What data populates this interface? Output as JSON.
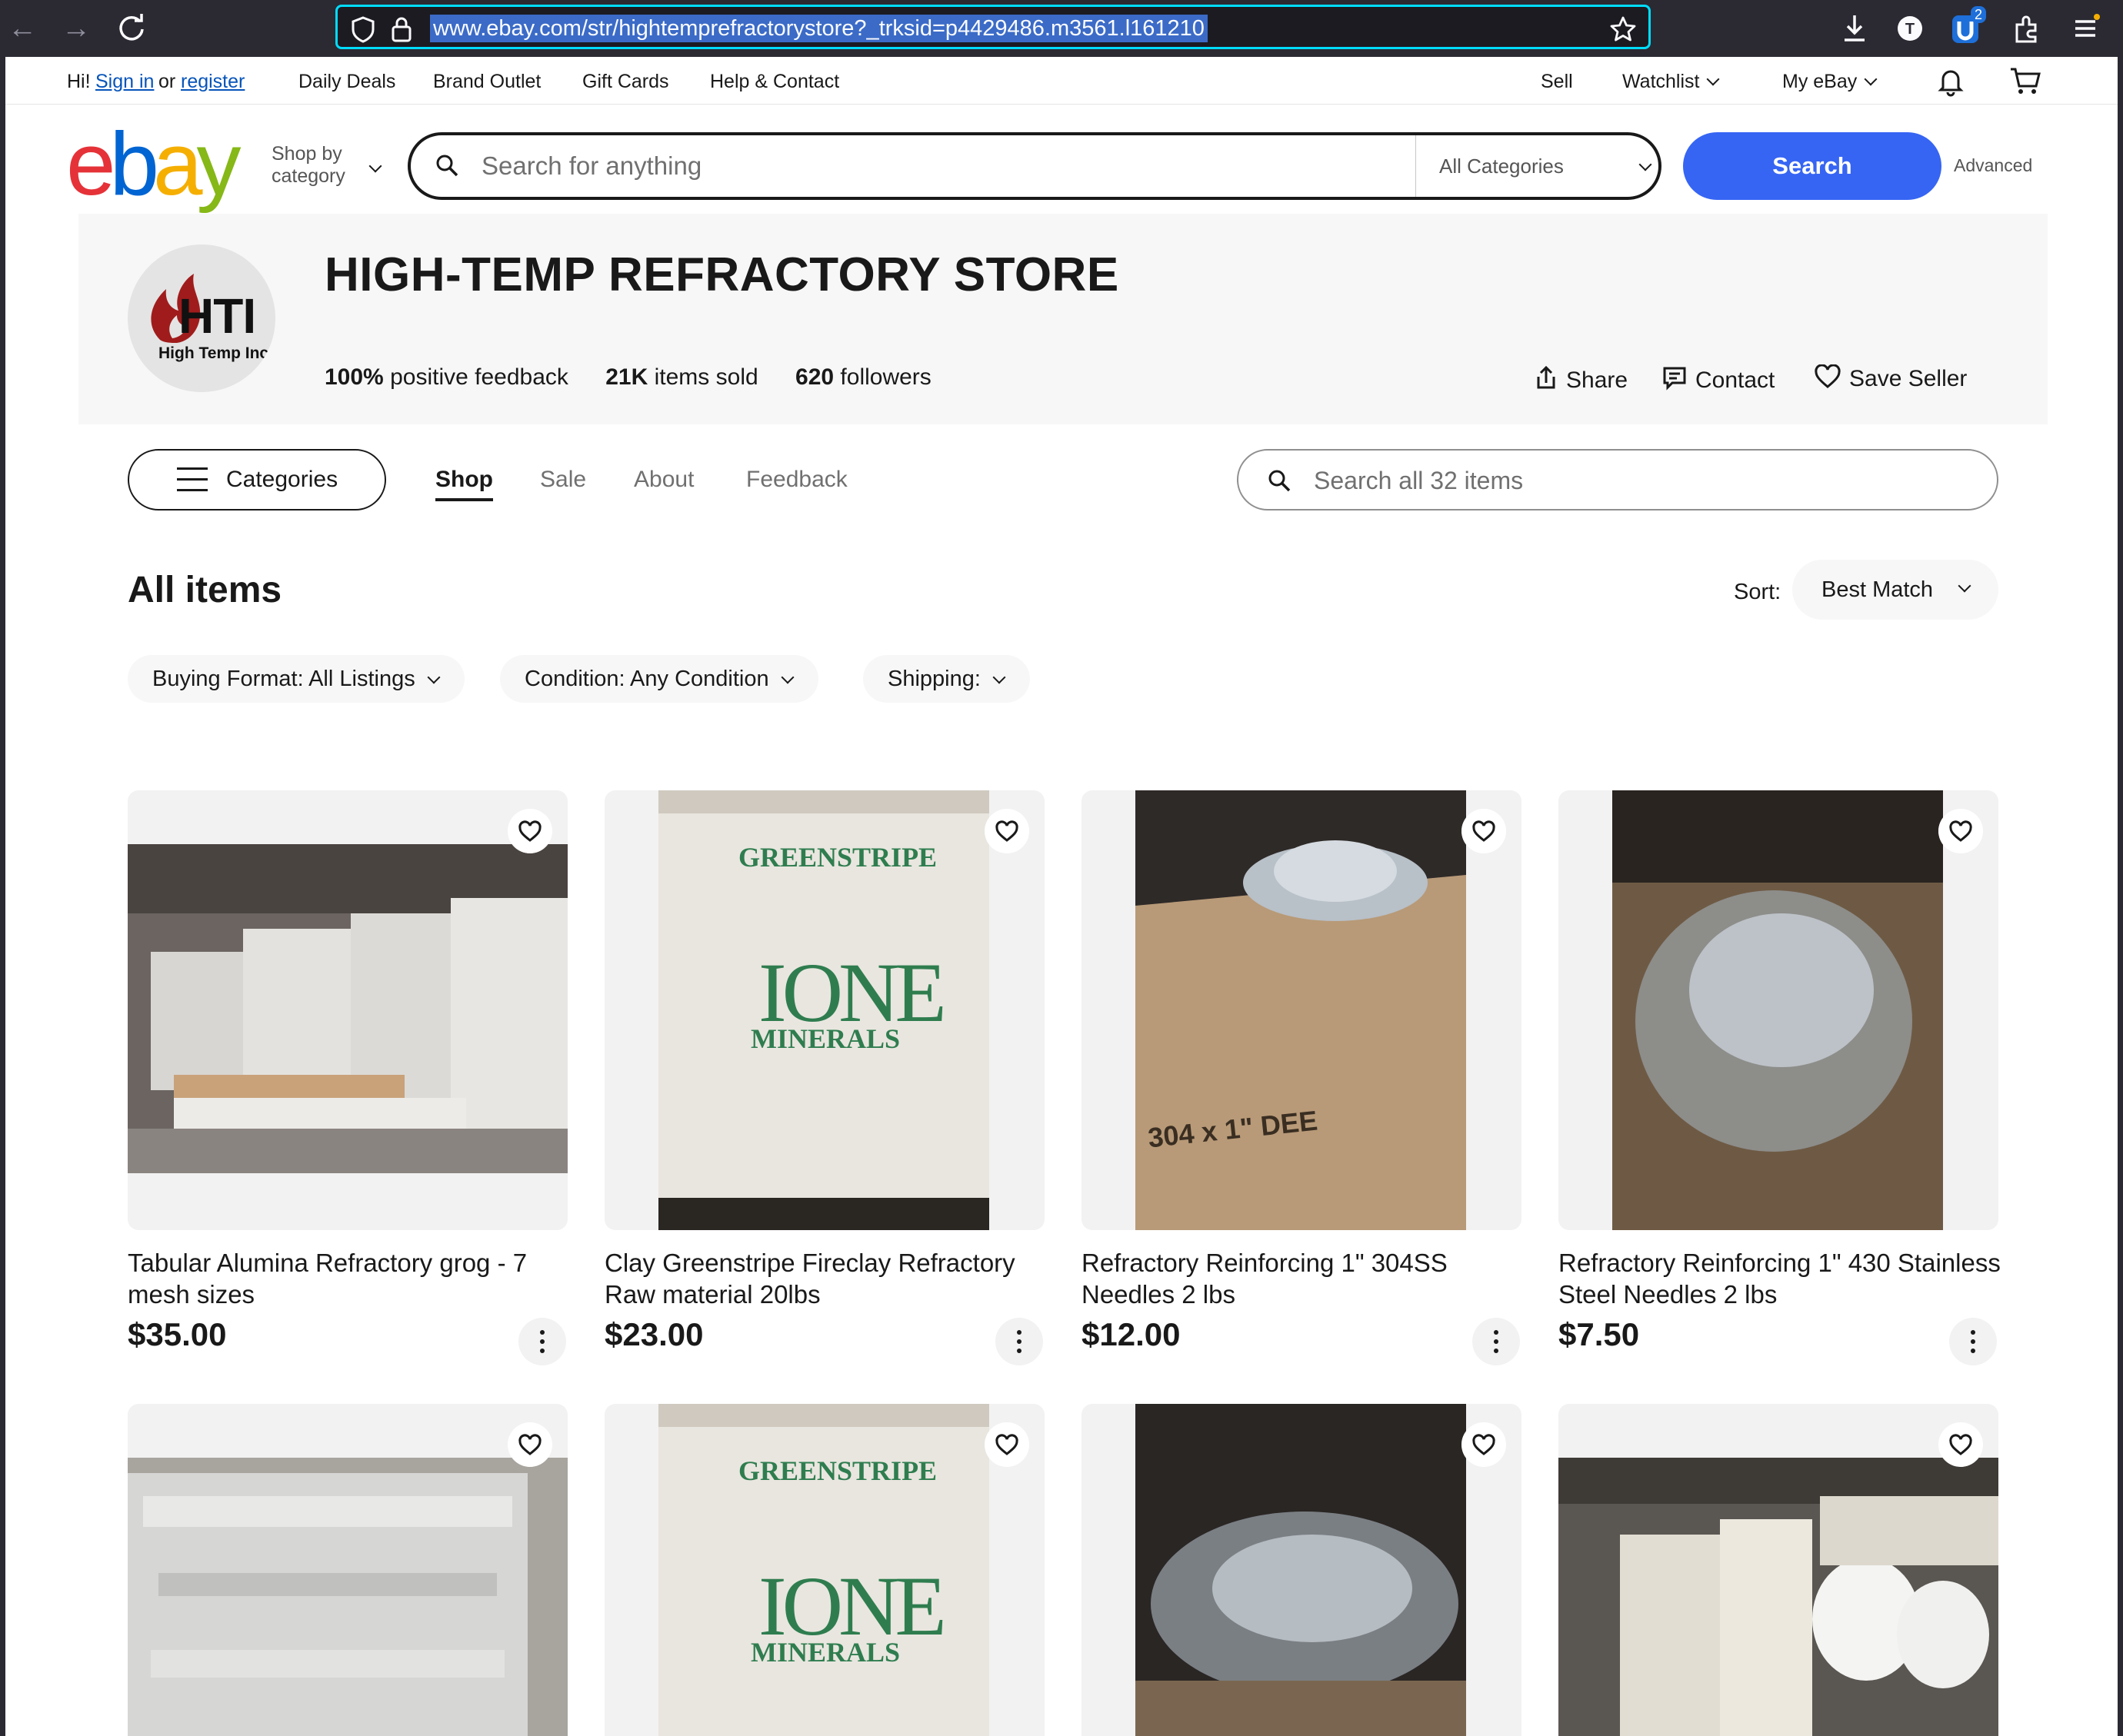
{
  "browser": {
    "url": "www.ebay.com/str/hightemprefractorystore?_trksid=p4429486.m3561.l161210",
    "extension_badge": "2"
  },
  "topnav": {
    "greeting": "Hi!",
    "sign_in": "Sign in",
    "or": "or",
    "register": "register",
    "links": [
      "Daily Deals",
      "Brand Outlet",
      "Gift Cards",
      "Help & Contact"
    ],
    "sell": "Sell",
    "watchlist": "Watchlist",
    "my_ebay": "My eBay"
  },
  "header": {
    "logo": {
      "e": "e",
      "b": "b",
      "a": "a",
      "y": "y"
    },
    "shop_by_line1": "Shop by",
    "shop_by_line2": "category",
    "search_placeholder": "Search for anything",
    "category_select": "All Categories",
    "search_button": "Search",
    "advanced": "Advanced"
  },
  "store": {
    "logo_text": "HTI",
    "logo_subtext": "High Temp Inc.",
    "title": "HIGH-TEMP REFRACTORY STORE",
    "feedback_value": "100%",
    "feedback_label": "positive feedback",
    "sold_value": "21K",
    "sold_label": "items sold",
    "followers_value": "620",
    "followers_label": "followers",
    "share": "Share",
    "contact": "Contact",
    "save_seller": "Save Seller"
  },
  "store_nav": {
    "categories": "Categories",
    "tabs": [
      "Shop",
      "Sale",
      "About",
      "Feedback"
    ],
    "search_placeholder": "Search all 32 items"
  },
  "listing": {
    "heading": "All items",
    "sort_label": "Sort:",
    "sort_value": "Best Match",
    "filters": [
      "Buying Format: All Listings",
      "Condition: Any Condition",
      "Shipping:"
    ]
  },
  "items": [
    {
      "title": "Tabular Alumina Refractory grog - 7 mesh sizes",
      "price": "$35.00"
    },
    {
      "title": "Clay Greenstripe Fireclay Refractory Raw material 20lbs",
      "price": "$23.00"
    },
    {
      "title": "Refractory Reinforcing 1\" 304SS Needles 2 lbs",
      "price": "$12.00"
    },
    {
      "title": "Refractory Reinforcing 1\" 430 Stainless Steel Needles 2 lbs",
      "price": "$7.50"
    }
  ],
  "image_labels": {
    "bag_brand": "GREENSTRIPE",
    "bag_logo": "IONE",
    "bag_maker": "MINERALS",
    "box_print": "304 x 1\" DEE"
  },
  "colors": {
    "search_button": "#3665f3",
    "link": "#0654ba",
    "url_focus": "#00ddff"
  }
}
